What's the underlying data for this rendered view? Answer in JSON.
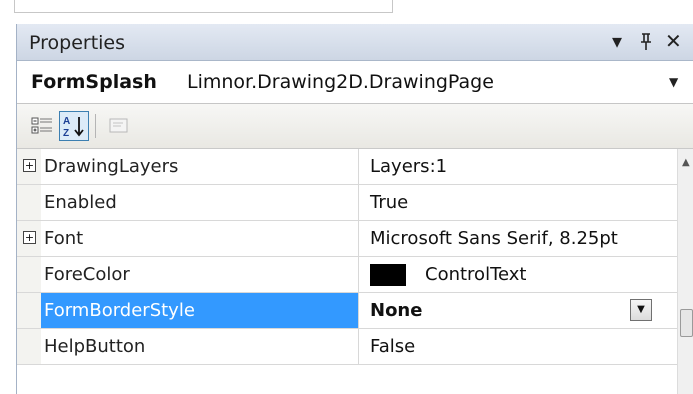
{
  "panel": {
    "title": "Properties",
    "controls": {
      "dropdown": "▾",
      "pin": "ᵖ",
      "close": "×"
    }
  },
  "object_selector": {
    "name": "FormSplash",
    "type": "Limnor.Drawing2D.DrawingPage"
  },
  "toolbar": {
    "buttons": [
      "categorized-icon",
      "alphabetical-icon",
      "property-pages-icon"
    ],
    "active": "alphabetical-icon"
  },
  "properties": [
    {
      "name": "DrawingLayers",
      "value": "Layers:1",
      "expandable": true
    },
    {
      "name": "Enabled",
      "value": "True",
      "expandable": false
    },
    {
      "name": "Font",
      "value": "Microsoft Sans Serif, 8.25pt",
      "expandable": true
    },
    {
      "name": "ForeColor",
      "value": "ControlText",
      "expandable": false,
      "color": "#000000"
    },
    {
      "name": "FormBorderStyle",
      "value": "None",
      "expandable": false,
      "selected": true
    },
    {
      "name": "HelpButton",
      "value": "False",
      "expandable": false
    }
  ],
  "colors": {
    "selection": "#3399ff",
    "accent": "#3c7fb1"
  }
}
